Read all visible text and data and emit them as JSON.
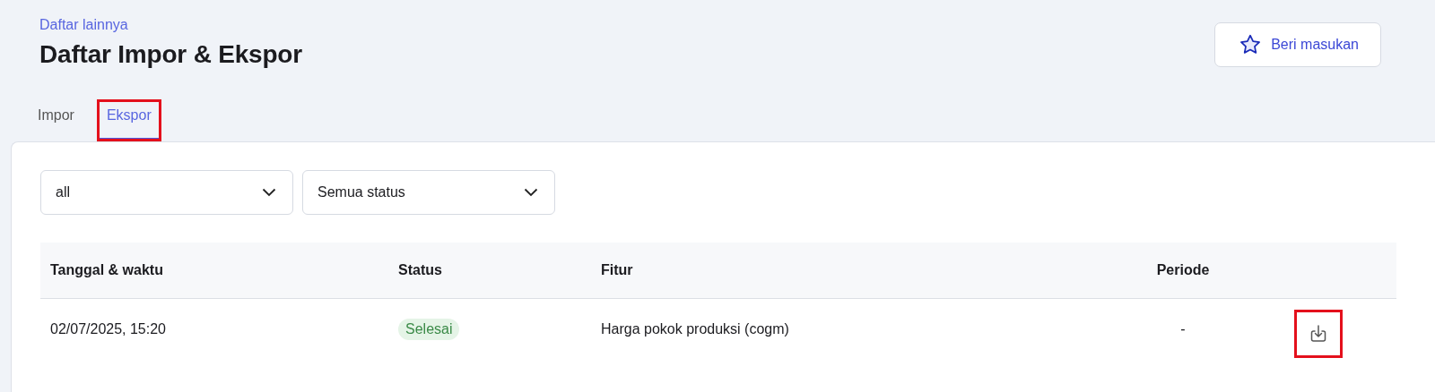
{
  "breadcrumb": "Daftar lainnya",
  "title": "Daftar Impor & Ekspor",
  "feedback_button": {
    "label": "Beri masukan"
  },
  "tabs": [
    {
      "label": "Impor",
      "selected": false,
      "highlighted": false
    },
    {
      "label": "Ekspor",
      "selected": true,
      "highlighted": true
    }
  ],
  "filters": [
    {
      "value": "all"
    },
    {
      "value": "Semua status"
    }
  ],
  "table": {
    "columns": [
      "Tanggal & waktu",
      "Status",
      "Fitur",
      "Periode"
    ],
    "rows": [
      {
        "date": "02/07/2025, 15:20",
        "status": "Selesai",
        "feature": "Harga pokok produksi (cogm)",
        "period": "-",
        "download_highlighted": true
      }
    ]
  }
}
